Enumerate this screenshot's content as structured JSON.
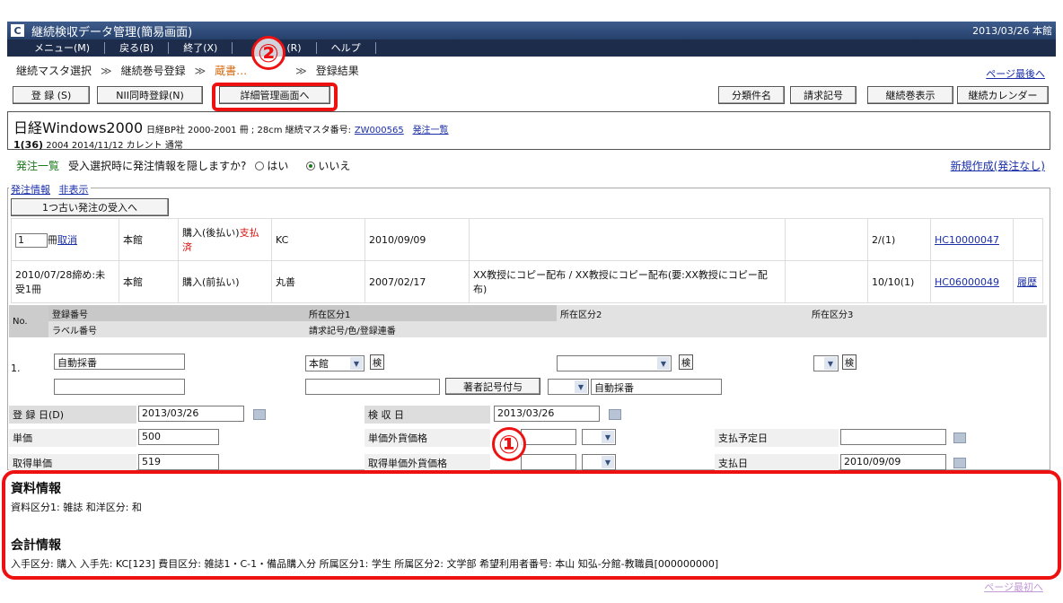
{
  "titlebar": {
    "logo": "C",
    "title": "継続検収データ管理(簡易画面)",
    "date": "2013/03/26 本館"
  },
  "menu": [
    "メニュー(M)",
    "戻る(B)",
    "終了(X)",
    "(R)",
    "ヘルプ"
  ],
  "breadcrumb": {
    "items": [
      "継続マスタ選択",
      "継続巻号登録",
      "蔵書…",
      "登録結果"
    ],
    "sep": "≫"
  },
  "links": {
    "page_last": "ページ最後へ",
    "page_first": "ページ最初へ"
  },
  "buttons": {
    "register": "登 録 (S)",
    "nii": "NII同時登録(N)",
    "detail": "詳細管理画面へ",
    "classify": "分類件名",
    "request_code": "請求記号",
    "show_vol": "継続巻表示",
    "calendar": "継続カレンダー",
    "older_order": "1つ古い発注の受入へ",
    "author_code": "著者記号付与"
  },
  "book": {
    "title": "日経Windows2000",
    "meta": "日経BP社 2000-2001 冊 ; 28cm 継続マスタ番号:",
    "master_no": "ZW000565",
    "order_list": "発注一覧",
    "line2_vol": "1(36)",
    "line2_rest": "2004 2014/11/12 カレント 通常"
  },
  "order_bar": {
    "label": "発注一覧",
    "question": "受入選択時に発注情報を隠しますか?",
    "yes": "はい",
    "no": "いいえ",
    "new": "新規作成(発注なし)"
  },
  "legend": {
    "label": "発注情報",
    "hide": "非表示"
  },
  "orders": [
    {
      "qty": "1",
      "unit": "冊",
      "cancel": "取消",
      "branch": "本館",
      "pay": "購入(後払い)",
      "pay_red": "支払済",
      "vendor": "KC",
      "date": "2010/09/09",
      "note": "",
      "count": "2/(1)",
      "no": "HC10000047",
      "hist": ""
    },
    {
      "qty": "2010/07/28締め:未受1冊",
      "unit": "",
      "cancel": "",
      "branch": "本館",
      "pay": "購入(前払い)",
      "pay_red": "",
      "vendor": "丸善",
      "date": "2007/02/17",
      "note": "XX教授にコピー配布 / XX教授にコピー配布(要:XX教授にコピー配布)",
      "count": "10/10(1)",
      "no": "HC06000049",
      "hist": "履歴"
    }
  ],
  "grid": {
    "no_label": "No.",
    "reg_no": "登録番号",
    "label_no": "ラベル番号",
    "loc1": "所在区分1",
    "loc2": "所在区分2",
    "loc3": "所在区分3",
    "request_color": "請求記号/色/登録連番",
    "row_no": "1.",
    "auto1": "自動採番",
    "branch": "本館",
    "ken": "検",
    "auto2": "自動採番"
  },
  "dates": {
    "reg_date_label": "登 録 日(D)",
    "reg_date": "2013/03/26",
    "insp_label": "検 収 日",
    "insp_date": "2013/03/26",
    "price_label": "単価",
    "price": "500",
    "fx_label": "単価外貨価格",
    "pay_plan_label": "支払予定日",
    "acq_label": "取得単価",
    "acq": "519",
    "acq_fx_label": "取得単価外貨価格",
    "pay_date_label": "支払日",
    "pay_date": "2010/09/09"
  },
  "info": {
    "material_title": "資料情報",
    "material_body": "資料区分1: 雑誌  和洋区分: 和",
    "account_title": "会計情報",
    "account_body": "入手区分: 購入  入手先: KC[123]  費目区分: 雑誌1・C-1・備品購入分  所属区分1: 学生  所属区分2: 文学部  希望利用者番号: 本山 知弘-分館-教職員[000000000]"
  },
  "annotations": {
    "one": "①",
    "two": "②"
  },
  "icons": {
    "calendar": "calendar-icon",
    "dropdown": "chevron-down-icon"
  }
}
